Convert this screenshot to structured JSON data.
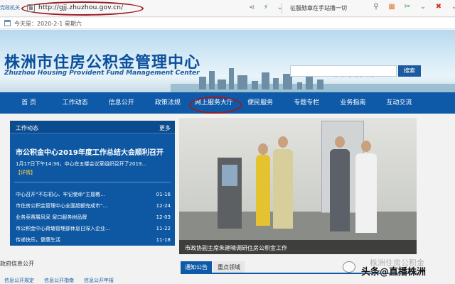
{
  "browser": {
    "gov_tab": "党政机关",
    "url": "http://gjj.zhuzhou.gov.cn/",
    "hint": "征服勋章在手站撸一切"
  },
  "site": {
    "date": "今天是：2020-2-1 星期六",
    "title": "株洲市住房公积金管理中心",
    "subtitle": "Zhuzhou Housing Provident Fund Management Center",
    "logo_text": "中国·株洲",
    "search_button": "搜索",
    "search_placeholder": ""
  },
  "nav": {
    "items": [
      "首 页",
      "工作动态",
      "信息公开",
      "政策法规",
      "网上服务大厅",
      "便民服务",
      "专题专栏",
      "业务指南",
      "互动交流"
    ]
  },
  "panel": {
    "title": "工作动态",
    "more": "更多",
    "headline": "市公积金中心2019年度工作总结大会顺利召开",
    "headline_desc": "1月17日下午14:30，中心在五楼会议室组织召开了2019...",
    "detail": "【详情】",
    "news": [
      {
        "title": "中心召开“不忘初心、牢记使命”主题教...",
        "date": "01-16"
      },
      {
        "title": "市住房公积金管理中心全面超额完成市“...",
        "date": "12-24"
      },
      {
        "title": "业务竞赛展风采 窗口服务树品牌",
        "date": "12-03"
      },
      {
        "title": "市公积金中心荷塘管理部休息日深入企业...",
        "date": "11-22"
      },
      {
        "title": "传递快乐，健康生活",
        "date": "11-18"
      }
    ]
  },
  "photo": {
    "caption": "市政协副主席朱建晴调研住房公积金工作"
  },
  "lower": {
    "gov_info": "政府信息公开",
    "gov_tabs": [
      "信息公开规定",
      "信息公开指南",
      "信息公开年报"
    ],
    "notice_tabs": [
      "通知公告",
      "重点领域"
    ]
  },
  "watermark": {
    "faint": "株洲住房公积金",
    "main": "头条@直播株洲"
  },
  "colors": {
    "nav": "#0e5aa8",
    "panel": "#0e58a3",
    "title": "#0b4f9c",
    "annotation": "#9a1c24"
  }
}
